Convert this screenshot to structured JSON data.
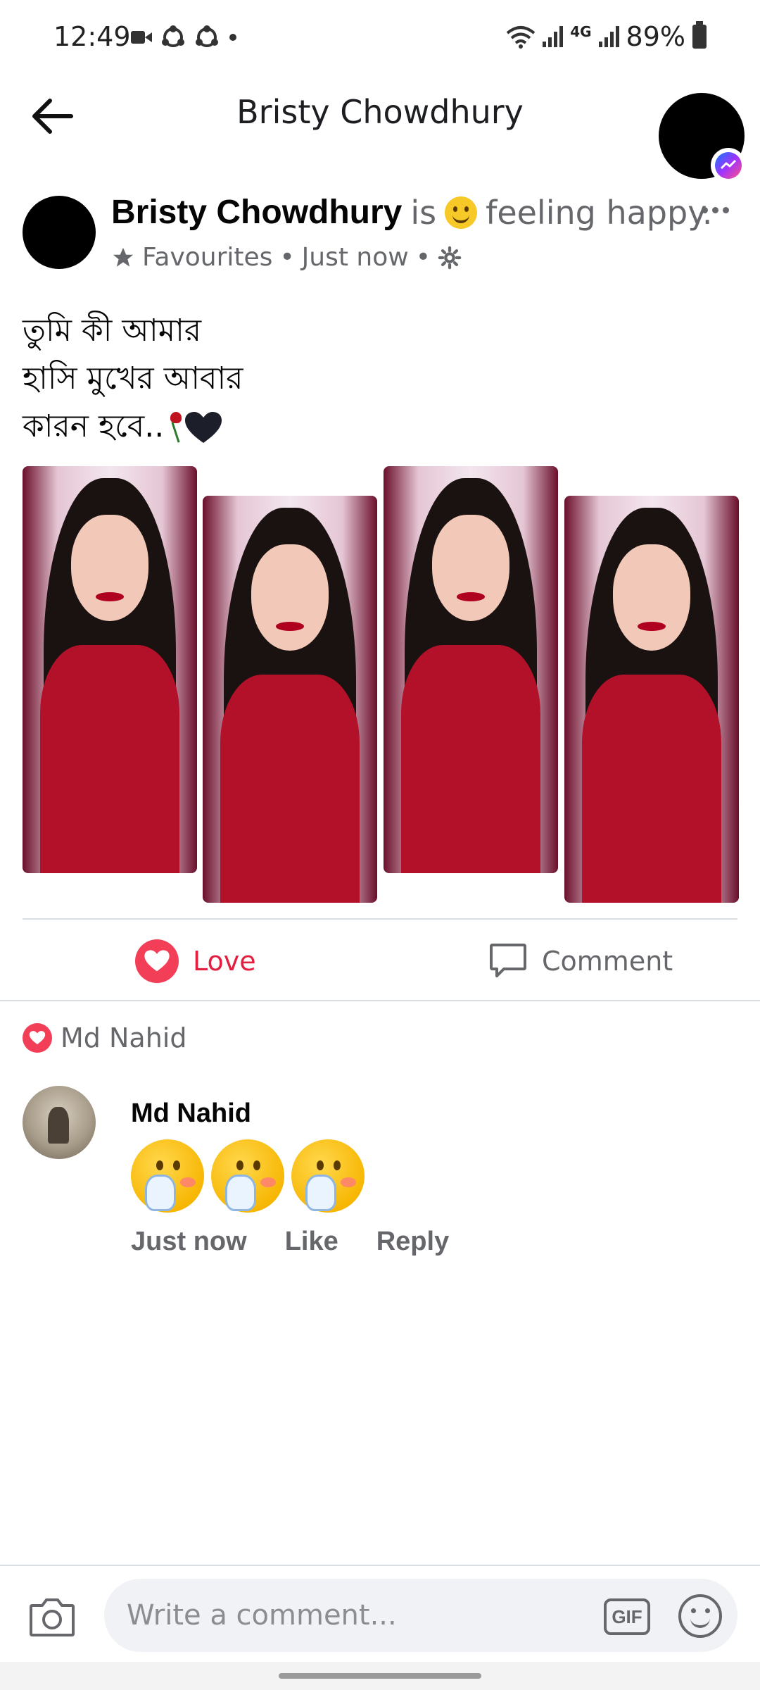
{
  "status_bar": {
    "time": "12:49",
    "battery": "89%",
    "network": "4G"
  },
  "header": {
    "title": "Bristy Chowdhury"
  },
  "post": {
    "author": "Bristy Chowdhury",
    "is_text": "is",
    "feeling": "feeling happy.",
    "audience": "Favourites",
    "timestamp": "Just now",
    "lines": [
      "তুমি কী আমার",
      "হাসি মুখের আবার",
      "কারন হবে.."
    ],
    "photo_count": 4
  },
  "actions": {
    "love_label": "Love",
    "comment_label": "Comment"
  },
  "reactions": {
    "reactor": "Md Nahid"
  },
  "comment": {
    "author": "Md Nahid",
    "time": "Just now",
    "like_label": "Like",
    "reply_label": "Reply"
  },
  "composer": {
    "placeholder": "Write a comment...",
    "gif_label": "GIF"
  },
  "colors": {
    "love": "#f33e58",
    "secondary_text": "#65676b",
    "dress": "#b3102a"
  }
}
